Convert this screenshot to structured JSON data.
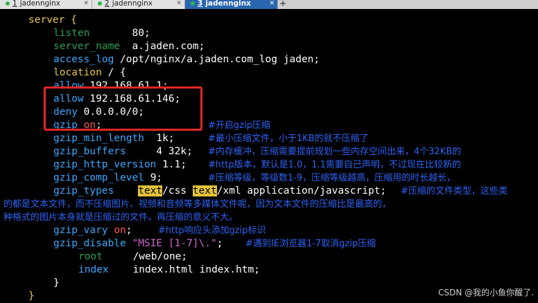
{
  "tabs": [
    {
      "number": "1",
      "label": "jadennginx",
      "active": false
    },
    {
      "number": "2",
      "label": "jadennginx",
      "active": false
    },
    {
      "number": "3",
      "label": "jadennginx",
      "active": true
    }
  ],
  "new_tab_label": "+",
  "code": {
    "l01": "server {",
    "l02_key": "listen",
    "l02_val": "80;",
    "l03_key": "server_name",
    "l03_val": "a.jaden.com;",
    "l04_key": "access_log",
    "l04_val": "/opt/nginx/a.jaden.com_log jaden;",
    "l05_key": "location",
    "l05_val": "/ {",
    "l06_key": "allow",
    "l06_val": "192.168.61.1;",
    "l07_key": "allow",
    "l07_val": "192.168.61.146;",
    "l08_key": "deny",
    "l08_val": "0.0.0.0/0;",
    "l09_key": "gzip",
    "l09_val": "on",
    "l09_end": ";",
    "l09_cmt": "#开启gzip压缩",
    "l10_key": "gzip_min_length",
    "l10_val": "1k;",
    "l10_cmt": "#最小压缩文件，小于1KB的就不压缩了",
    "l11_key": "gzip_buffers",
    "l11_val": "4 32k;",
    "l11_cmt": "#内存缓冲，压缩需要提前规划一些内存空间出来，4个32KB的",
    "l12_key": "gzip_http_version",
    "l12_val": "1.1;",
    "l12_cmt": "#http版本，默认是1.0，1.1需要自己声明，不过现在比较新的",
    "l13_key": "gzip_comp_level",
    "l13_val": "9;",
    "l13_cmt": "#压缩等级，等级数1-9，压缩等级越高，压缩用的时长越长，",
    "l14_key": "gzip_types",
    "l14_hl1": "text",
    "l14_mid": "/css ",
    "l14_hl2": "text",
    "l14_rest": "/xml application/javascript;",
    "l14_cmt": "#压缩的文件类型，这些类",
    "l15_cmt": "的都是文本文件，而不压缩图片、视频和音频等多媒体文件呢，因为文本文件的压缩比是最高的，",
    "l16_cmt": "种格式的图片本身就是压缩过的文件，再压缩的意义不大。",
    "l17_key": "gzip_vary",
    "l17_val": "on",
    "l17_end": ";",
    "l17_cmt": "#http响应头添加gzip标识",
    "l18_key": "gzip_disable",
    "l18_val": "\"MSIE [1-7]\\.\"",
    "l18_end": ";",
    "l18_cmt": "#遇到IE浏览器1-7取消gzip压缩",
    "l19_key": "root",
    "l19_val": "/web/one;",
    "l20_key": "index",
    "l20_val": "index.html index.htm;",
    "l21": "}",
    "l22": "}"
  },
  "watermark": "CSDN @我的小鱼你醒了.",
  "colors": {
    "directive": "#3aa9ff",
    "keyword": "#e8c74e",
    "comment": "#2f63f5",
    "disabled_directive": "#2f9f55",
    "on_value": "#ff5a5a",
    "string": "#cc66cc",
    "highlight": "#e3c33a",
    "annotation_box": "#e32626",
    "active_tab": "#2a66b0"
  }
}
